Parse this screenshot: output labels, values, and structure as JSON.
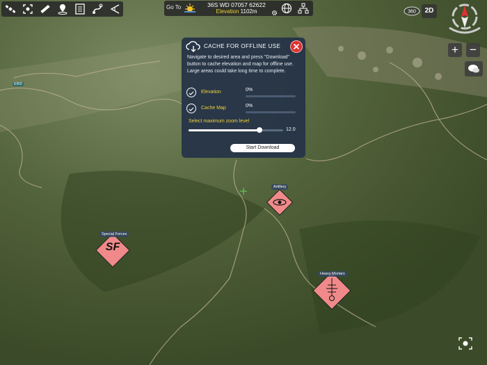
{
  "toolbar": {
    "icons": [
      "satellite-icon",
      "capture-icon",
      "ruler-icon",
      "location-pin-icon",
      "list-icon",
      "route-icon",
      "los-icon"
    ]
  },
  "goto": {
    "label": "Go To",
    "mgrs": "36S WD 07057 62622",
    "elevation_label": "Elevation",
    "elevation_value": "1102m"
  },
  "view_controls": {
    "view3d_label": "360",
    "view2d_label": "2D",
    "zoom_in": "+",
    "zoom_out": "−"
  },
  "dialog": {
    "title": "CACHE FOR OFFLINE USE",
    "description": "Navigate to desired area and press \"Download\" button to cache elevation and map for offline use. Large areas could take long time to complete.",
    "rows": [
      {
        "label": "Elevation",
        "percent": "0%",
        "progress": 0
      },
      {
        "label": "Cache Map",
        "percent": "0%",
        "progress": 0
      }
    ],
    "zoom_label": "Select maximum zoom level",
    "zoom_value": "12.0",
    "zoom_fraction": 0.75,
    "start_button": "Start Download"
  },
  "map": {
    "road_labels": [
      "E903"
    ],
    "units": [
      {
        "name": "Special Forces",
        "symbol": "SF"
      },
      {
        "name": "Artillery",
        "symbol": "artillery"
      },
      {
        "name": "Heavy Mortars",
        "symbol": "mortar"
      }
    ]
  },
  "colors": {
    "accent_yellow": "#f0d13a",
    "dialog_bg": "#263448",
    "hostile_fill": "#f08a8a",
    "close_red": "#e03030"
  }
}
